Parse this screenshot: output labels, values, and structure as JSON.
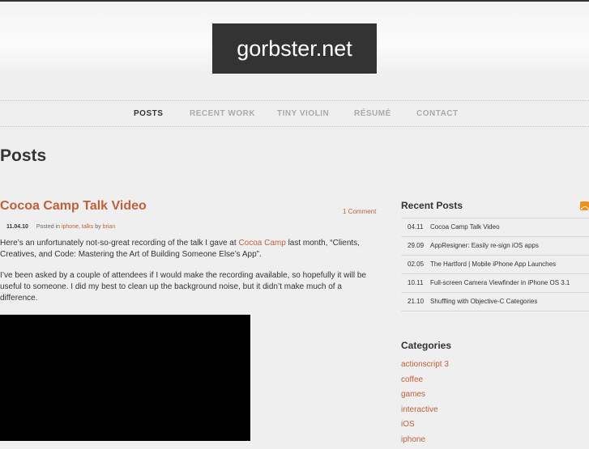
{
  "site": {
    "logo": "gorbster.net"
  },
  "nav": {
    "items": [
      {
        "label": "POSTS"
      },
      {
        "label": "RECENT WORK"
      },
      {
        "label": "TINY VIOLIN"
      },
      {
        "label": "RÉSUMÉ"
      },
      {
        "label": "CONTACT"
      }
    ]
  },
  "page": {
    "title": "Posts"
  },
  "post": {
    "title": "Cocoa Camp Talk Video",
    "comments": "1 Comment",
    "date": "11.04.10",
    "posted_in": "Posted in",
    "tag1": "iphone",
    "sep": ",",
    "tag2": "talks",
    "by": "by",
    "author": "brian",
    "p1_before": "Here’s an unfortunately not-so-great recording of the talk I gave at",
    "p1_link": "Cocoa Camp",
    "p1_after": "last month, “Clients, Creatives, and Code: Mastering the Art of Building Someone Else’s App”.",
    "p2": "I’ve been asked by a couple of attendees if I would make the recording available, so hopefully it will be useful to someone. I did my best to clean up the background noise, but it didn’t make much of a difference."
  },
  "sidebar": {
    "recent_title": "Recent Posts",
    "recent": [
      {
        "date": "04.11",
        "title": "Cocoa Camp Talk Video"
      },
      {
        "date": "29.09",
        "title": "AppResigner: Easily re-sign iOS apps"
      },
      {
        "date": "02.05",
        "title": "The Hartford | Mobile iPhone App Launches"
      },
      {
        "date": "10.11",
        "title": "Full-screen Camera Viewfinder in iPhone OS 3.1"
      },
      {
        "date": "21.10",
        "title": "Shuffling with Objective-C Categories"
      }
    ],
    "categories_title": "Categories",
    "categories": [
      {
        "label": "actionscript 3"
      },
      {
        "label": "coffee"
      },
      {
        "label": "games"
      },
      {
        "label": "interactive"
      },
      {
        "label": "iOS"
      },
      {
        "label": "iphone"
      }
    ]
  },
  "colors": {
    "accent": "#c0603a",
    "logo_bg": "#333333",
    "rss": "#f0901e"
  }
}
